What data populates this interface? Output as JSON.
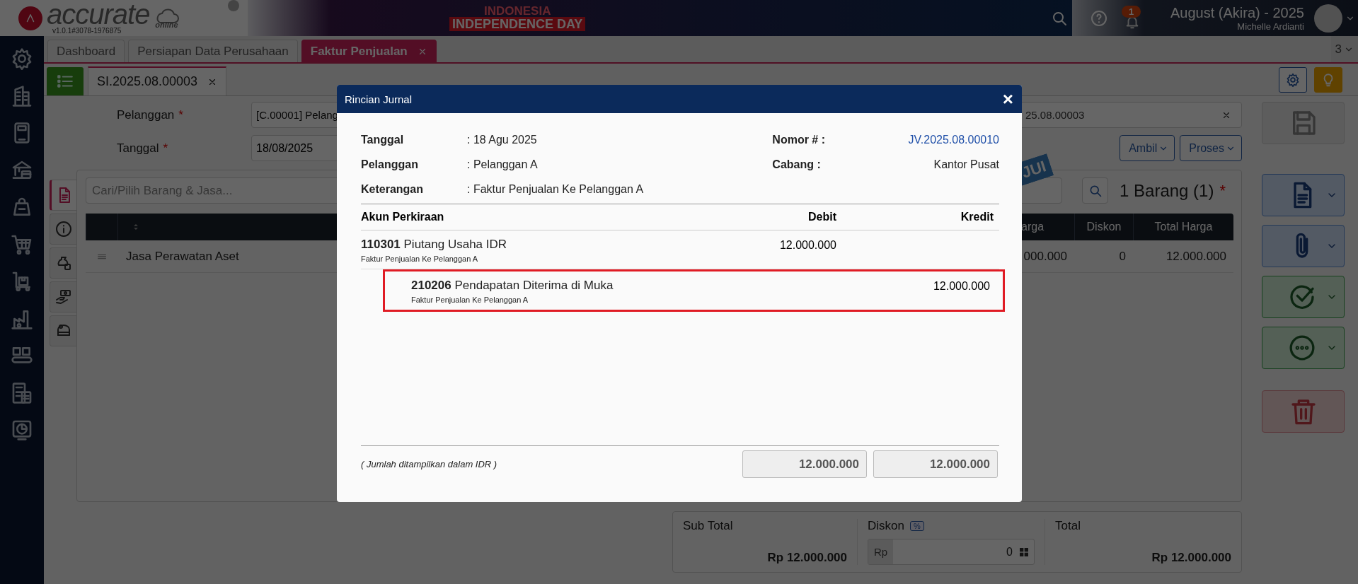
{
  "header": {
    "logo": {
      "wordmark": "accurate",
      "tagline": "online",
      "version": "v1.0.1#3078-1976875"
    },
    "banner": {
      "line_1": "INDONESIA",
      "line_2": "INDEPENDENCE DAY"
    },
    "notification_count": "1",
    "user": {
      "period": "August (Akira) - 2025",
      "name": "Michelle Ardianti"
    }
  },
  "tabs": [
    {
      "label": "Dashboard",
      "selected": false
    },
    {
      "label": "Persiapan Data Perusahaan",
      "selected": false
    },
    {
      "label": "Faktur Penjualan",
      "selected": true
    }
  ],
  "tab_overflow": "3",
  "document_tabs": [
    {
      "label": "SI.2025.08.00003",
      "selected": true
    }
  ],
  "form": {
    "fields": [
      {
        "label": "Pelanggan",
        "required_mark": "*",
        "value": "[C.00001] Pelang"
      },
      {
        "label": "Tanggal",
        "required_mark": "*",
        "value": "18/08/2025"
      }
    ],
    "number_value": "25.08.00003",
    "stamp": "JUI",
    "buttons": [
      "Ambil",
      "Proses"
    ]
  },
  "items": {
    "side_tabs": [
      {
        "selected": true
      },
      {
        "selected": false
      },
      {
        "selected": false
      },
      {
        "selected": false
      },
      {
        "selected": false
      }
    ],
    "search_placeholder": "Cari/Pilih Barang & Jasa...",
    "count": "1 Barang (1)",
    "count_mark": "*",
    "columns": [
      "arga",
      "Diskon",
      "Total Harga"
    ],
    "rows": [
      {
        "item": "Jasa Perawatan Aset",
        "price": "000.000",
        "discount": "0",
        "total": "12.000.000"
      }
    ]
  },
  "summary": {
    "subtotal_label": "Sub Total",
    "subtotal": "Rp 12.000.000",
    "discount_label": "Diskon",
    "discount_unit": "%",
    "discount_prefix": "Rp",
    "discount_value": "0",
    "total_label": "Total",
    "total": "Rp 12.000.000"
  },
  "dialog": {
    "title": "Rincian Jurnal",
    "close": "×",
    "info_left": [
      {
        "label": "Tanggal",
        "value": ": 18 Agu 2025"
      },
      {
        "label": "Pelanggan",
        "value": ": Pelanggan A"
      },
      {
        "label": "Keterangan",
        "value": ": Faktur Penjualan Ke Pelanggan A"
      }
    ],
    "info_right": [
      {
        "label": "Nomor # :",
        "value": "JV.2025.08.00010",
        "link": true
      },
      {
        "label": "Cabang :",
        "value": "Kantor Pusat",
        "link": false
      }
    ],
    "columns": [
      "Akun Perkiraan",
      "Debit",
      "Kredit"
    ],
    "entries": [
      {
        "code": "110301",
        "name": "Piutang Usaha IDR",
        "note": "Faktur Penjualan Ke Pelanggan A",
        "debit": "12.000.000",
        "highlighted": false
      },
      {
        "code": "210206",
        "name": "Pendapatan Diterima di Muka",
        "note": "Faktur Penjualan Ke Pelanggan A",
        "credit": "12.000.000",
        "highlighted": true
      }
    ],
    "footer_note": "( Jumlah ditampilkan dalam IDR )",
    "totals": [
      "12.000.000",
      "12.000.000"
    ]
  }
}
